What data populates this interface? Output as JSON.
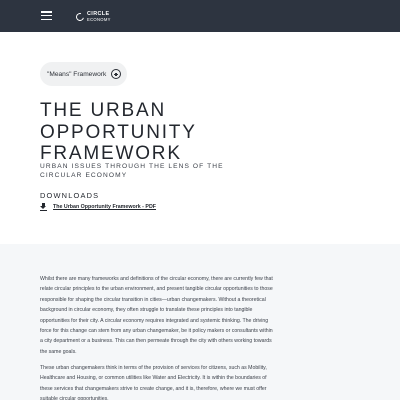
{
  "header": {
    "logo_line1": "CIRCLE",
    "logo_line2": "ECONOMY"
  },
  "hero": {
    "chip_label": "\"Means\" Framework",
    "title": "THE URBAN OPPORTUNITY FRAMEWORK",
    "subtitle": "URBAN ISSUES THROUGH THE LENS OF THE CIRCULAR ECONOMY",
    "downloads_heading": "DOWNLOADS",
    "download_link": "The Urban Opportunity Framework - PDF"
  },
  "body": {
    "paragraph1": "Whilst there are many frameworks and definitions of the circular economy, there are currently few that relate circular principles to the urban environment, and present tangible circular opportunities to those responsible for shaping the circular transition in cities—urban changemakers. Without a theoretical background in circular economy, they often struggle to translate these principles into tangible opportunities for their city. A circular economy requires integrated and systemic thinking. The driving force for this change can stem from any urban changemaker, be it policy makers or consultants within a city department or a business. This can then permeate through the city with others working towards the same goals.",
    "paragraph2": "These urban changemakers think in terms of the provision of services for citizens, such as Mobility, Healthcare and Housing, or common utilities like Water and Electricity. It is within the boundaries of these services that changemakers strive to create change, and it is, therefore, where we must offer suitable circular opportunities."
  },
  "colors": {
    "header_bg": "#2d3440",
    "chip_bg": "#f0f1f2",
    "body_bg": "#f5f7f9",
    "text": "#23272e"
  },
  "icons": [
    "menu-icon",
    "logo-mark-icon",
    "plus-circle-icon",
    "download-icon"
  ]
}
